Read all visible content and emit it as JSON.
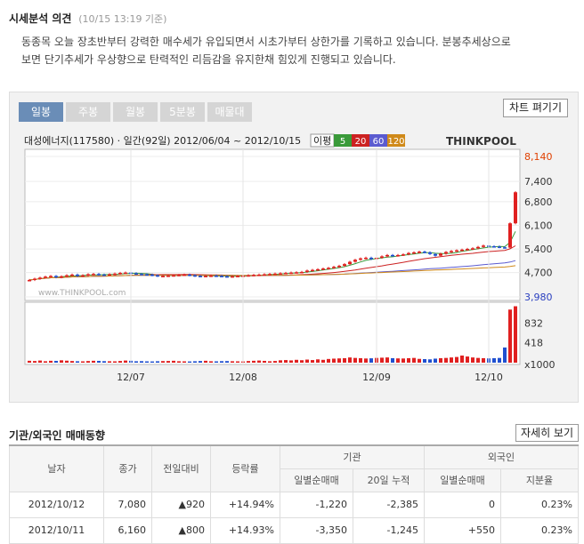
{
  "opinion": {
    "title": "시세분석 의견",
    "time": "(10/15 13:19 기준)",
    "line1": "동종목 오늘 장초반부터 강력한 매수세가 유입되면서 시초가부터 상한가를 기록하고 있습니다. 분봉추세상으로",
    "line2": "보면 단기추세가 우상향으로 탄력적인 리듬감을 유지한채 힘있게 진행되고 있습니다."
  },
  "chart_tabs": [
    "일봉",
    "주봉",
    "월봉",
    "5분봉",
    "매물대"
  ],
  "chart_open_label": "차트 펴기기",
  "chart_header": "대성에너지(117580) · 일간(92일) 2012/06/04 ~ 2012/10/15",
  "ma_label": "이평",
  "ma_periods": [
    "5",
    "20",
    "60",
    "120"
  ],
  "ma_colors": [
    "#3a9a3a",
    "#cc2222",
    "#5b5bd0",
    "#d08a1a"
  ],
  "brand": "THINKPOOL",
  "watermark": "www.THINKPOOL.com",
  "chart_data": {
    "type": "candlestick",
    "x_ticks": [
      "12/07",
      "12/08",
      "12/09",
      "12/10"
    ],
    "price_ticks": [
      "8,140",
      "7,400",
      "6,800",
      "6,100",
      "5,400",
      "4,700",
      "3,980"
    ],
    "price_range": [
      3980,
      8140
    ],
    "volume_ticks": [
      "832",
      "418",
      "x1000"
    ],
    "volume_max": 1200,
    "closes": [
      4480,
      4520,
      4550,
      4580,
      4600,
      4560,
      4590,
      4620,
      4640,
      4600,
      4620,
      4650,
      4660,
      4640,
      4630,
      4650,
      4670,
      4690,
      4700,
      4680,
      4660,
      4650,
      4640,
      4620,
      4600,
      4600,
      4610,
      4620,
      4630,
      4640,
      4620,
      4600,
      4590,
      4600,
      4610,
      4600,
      4590,
      4580,
      4590,
      4600,
      4610,
      4620,
      4630,
      4640,
      4650,
      4660,
      4670,
      4680,
      4690,
      4700,
      4710,
      4720,
      4760,
      4780,
      4800,
      4820,
      4840,
      4870,
      4900,
      4950,
      5020,
      5080,
      5120,
      5140,
      5100,
      5140,
      5180,
      5220,
      5200,
      5220,
      5240,
      5280,
      5300,
      5320,
      5300,
      5250,
      5200,
      5260,
      5310,
      5340,
      5360,
      5380,
      5400,
      5420,
      5460,
      5500,
      5480,
      5470,
      5450,
      5440,
      6160,
      7080
    ],
    "volumes": [
      40,
      35,
      45,
      30,
      40,
      38,
      50,
      42,
      35,
      30,
      28,
      35,
      40,
      38,
      32,
      30,
      28,
      36,
      45,
      40,
      30,
      32,
      28,
      26,
      30,
      34,
      36,
      40,
      30,
      28,
      26,
      30,
      35,
      40,
      30,
      28,
      32,
      34,
      30,
      28,
      26,
      35,
      40,
      45,
      38,
      30,
      36,
      50,
      55,
      48,
      60,
      52,
      65,
      55,
      70,
      60,
      78,
      85,
      90,
      95,
      110,
      100,
      95,
      88,
      92,
      100,
      105,
      110,
      95,
      90,
      88,
      95,
      100,
      80,
      75,
      70,
      85,
      95,
      100,
      110,
      120,
      150,
      130,
      110,
      100,
      95,
      90,
      95,
      100,
      320,
      1120,
      1190
    ]
  },
  "trade_section": {
    "title": "기관/외국인 매매동향",
    "detail_label": "자세히 보기",
    "headers": {
      "date": "날자",
      "close": "종가",
      "change": "전일대비",
      "rate": "등락률",
      "inst": "기관",
      "foreign": "외국인",
      "daily_net": "일별순매매",
      "cum20": "20일 누적",
      "foreign_daily_net": "일별순매매",
      "share": "지분율"
    },
    "rows": [
      {
        "date": "2012/10/12",
        "close": "7,080",
        "change": "▲920",
        "rate": "+14.94%",
        "inst_daily": "-1,220",
        "inst_cum": "-2,385",
        "foreign_daily": "0",
        "share": "0.23%"
      },
      {
        "date": "2012/10/11",
        "close": "6,160",
        "change": "▲800",
        "rate": "+14.93%",
        "inst_daily": "-3,350",
        "inst_cum": "-1,245",
        "foreign_daily": "+550",
        "share": "0.23%"
      }
    ]
  }
}
